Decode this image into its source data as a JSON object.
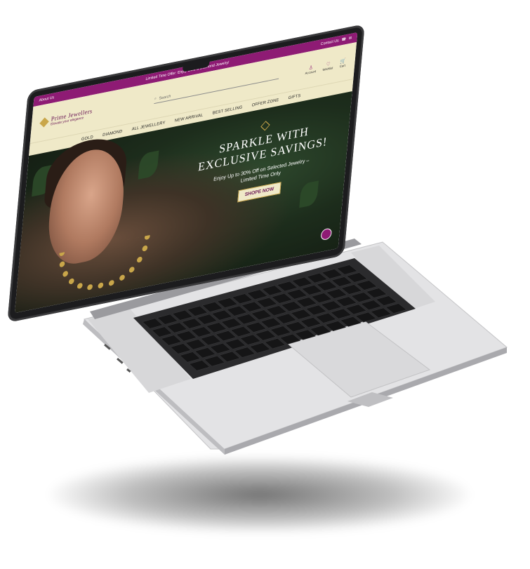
{
  "topbar": {
    "left": "About Us",
    "promo": "Limited Time Offer: Enjoy Gold & Diamond Jewelry!",
    "contact": "Contact Us"
  },
  "header": {
    "brand": "Prime Jewellers",
    "tagline": "Elevate your elegance",
    "search_placeholder": "Search",
    "icons": [
      {
        "label": "Account",
        "icon": "user-icon"
      },
      {
        "label": "Wishlist",
        "icon": "heart-icon"
      },
      {
        "label": "Cart",
        "icon": "cart-icon"
      }
    ]
  },
  "nav": [
    "GOLD",
    "DIAMOND",
    "ALL JEWELLERY",
    "NEW ARRIVAL",
    "BEST SELLING",
    "OFFER ZONE",
    "GIFTS"
  ],
  "hero": {
    "title_line1": "SPARKLE WITH",
    "title_line2": "EXCLUSIVE SAVINGS!",
    "subtitle_line1": "Enjoy Up to 30% Off on Selected Jewelry –",
    "subtitle_line2": "Limited Time Only",
    "cta": "SHOPE NOW"
  },
  "colors": {
    "brand_purple": "#8e1b74",
    "cream": "#efe9c8",
    "gold": "#c9a64a"
  }
}
